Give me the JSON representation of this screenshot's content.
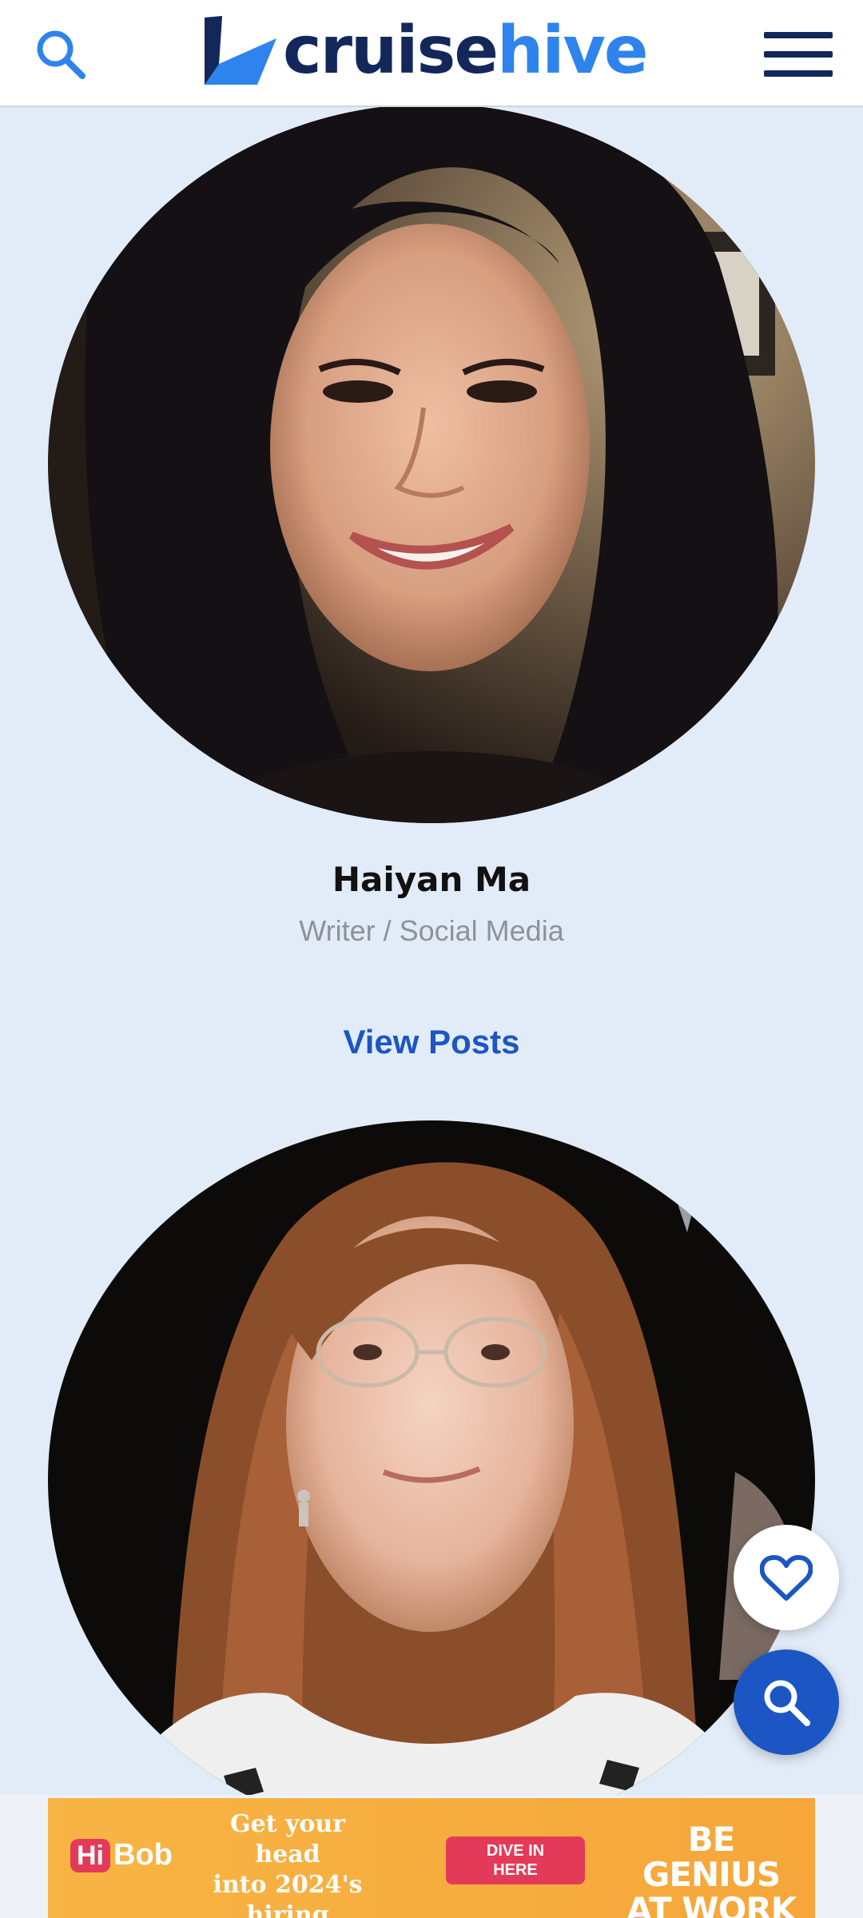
{
  "header": {
    "logo_part1": "cruise",
    "logo_part2": "hive",
    "search_icon": "search-icon",
    "menu_icon": "hamburger-menu-icon"
  },
  "authors": [
    {
      "name": "Haiyan Ma",
      "role": "Writer / Social Media",
      "link_label": "View Posts",
      "photo": "author-photo-woman-dark-hair"
    },
    {
      "photo": "author-photo-woman-glasses-auburn-hair"
    }
  ],
  "floating_buttons": {
    "favorite_icon": "heart-icon",
    "search_icon": "search-icon"
  },
  "ad": {
    "brand_hi": "Hi",
    "brand_bob": "Bob",
    "copy_line1": "Get your head",
    "copy_line2": "into 2024's",
    "copy_line3": "hiring headaches",
    "cta_line1": "DIVE IN",
    "cta_line2": "HERE",
    "tagline_line1": "BE GENIUS",
    "tagline_line2": "AT WORK"
  },
  "colors": {
    "brand_dark": "#14275a",
    "brand_light": "#2e84ec",
    "link": "#1c56c4",
    "page_bg": "#e2ecf8",
    "ad_bg": "#f7b544",
    "ad_accent": "#e43a59"
  }
}
